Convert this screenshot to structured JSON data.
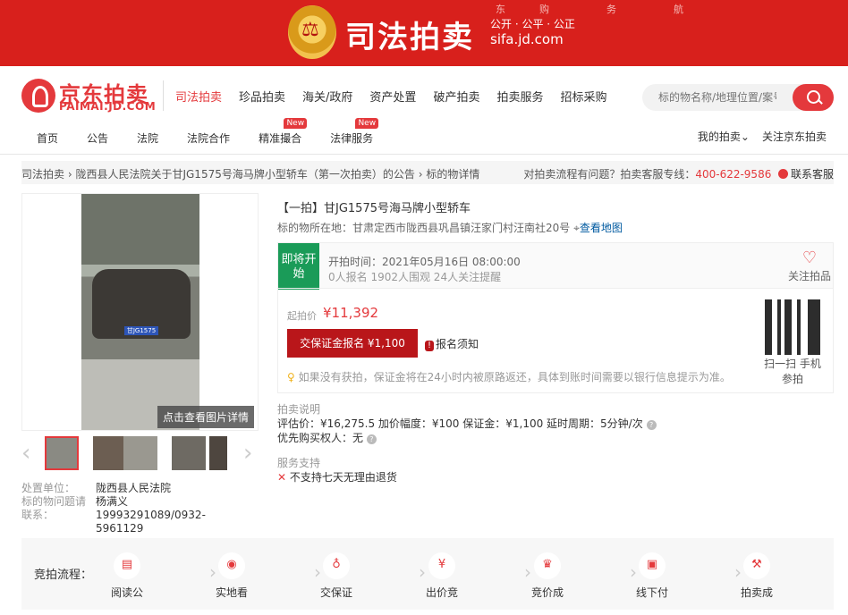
{
  "banner": {
    "title": "司法拍卖",
    "slogan": "公开 · 公平 · 公正",
    "domain": "sifa.jd.com",
    "nav": [
      "东",
      "购",
      "务",
      "航"
    ]
  },
  "logo": {
    "name": "京东拍卖",
    "sub": "PAIMAI.JD.COM"
  },
  "main_nav": [
    "司法拍卖",
    "珍品拍卖",
    "海关/政府",
    "资产处置",
    "破产拍卖",
    "拍卖服务",
    "招标采购"
  ],
  "search": {
    "placeholder": "标的物名称/地理位置/案号"
  },
  "sub_nav": [
    {
      "label": "首页",
      "badge": ""
    },
    {
      "label": "公告",
      "badge": ""
    },
    {
      "label": "法院",
      "badge": ""
    },
    {
      "label": "法院合作",
      "badge": ""
    },
    {
      "label": "精准撮合",
      "badge": "New"
    },
    {
      "label": "法律服务",
      "badge": "New"
    }
  ],
  "right_nav": {
    "my": "我的拍卖",
    "follow": "关注京东拍卖"
  },
  "breadcrumb": {
    "items": [
      "司法拍卖",
      "陇西县人民法院关于甘JG1575号海马牌小型轿车（第一次拍卖）的公告",
      "标的物详情"
    ],
    "help": "对拍卖流程有问题？拍卖客服专线：",
    "phone": "400-622-9586",
    "contact": "联系客服"
  },
  "photo": {
    "more": "点击查看图片详情",
    "plate": "甘JG1575"
  },
  "seller": {
    "unit_label": "处置单位：",
    "unit": "陇西县人民法院",
    "contact_label": "标的物问题请联系：",
    "contact": "杨满义 19993291089/0932-5961129"
  },
  "item": {
    "title": "【一拍】甘JG1575号海马牌小型轿车",
    "location_label": "标的物所在地：",
    "location": "甘肃定西市陇西县巩昌镇汪家门村汪南社20号",
    "map": "查看地图"
  },
  "status": {
    "tag": "即将开始",
    "time": "开拍时间：2021年05月16日 08:00:00",
    "stats": "0人报名   1902人围观   24人关注提醒",
    "follow": "关注拍品"
  },
  "price": {
    "label": "起拍价",
    "value": "¥11,392",
    "bid_button": "交保证金报名 ¥1,100",
    "notice": "报名须知",
    "tip": "如果没有获拍，保证金将在24小时内被原路返还，具体到账时间需要以银行信息提示为准。",
    "qr_text": "扫一扫 手机参拍"
  },
  "rules": {
    "heading": "拍卖说明",
    "line1": "评估价：¥16,275.5    加价幅度：¥100    保证金：¥1,100    延时周期：5分钟/次",
    "line2": "优先购买权人：无"
  },
  "service": {
    "heading": "服务支持",
    "item": "不支持七天无理由退货"
  },
  "flow": {
    "label": "竞拍流程：",
    "steps": [
      {
        "label": "阅读公",
        "icon": "document-icon",
        "glyph": "▤"
      },
      {
        "label": "实地看",
        "icon": "eye-icon",
        "glyph": "◉"
      },
      {
        "label": "交保证",
        "icon": "money-bag-icon",
        "glyph": "♁"
      },
      {
        "label": "出价竞",
        "icon": "yen-coin-icon",
        "glyph": "¥"
      },
      {
        "label": "竞价成",
        "icon": "thumbs-up-icon",
        "glyph": "♛"
      },
      {
        "label": "线下付",
        "icon": "wallet-icon",
        "glyph": "▣"
      },
      {
        "label": "拍卖成",
        "icon": "gavel-icon",
        "glyph": "⚒"
      }
    ]
  },
  "colors": {
    "brand_red": "#e4393c",
    "banner_red": "#d8201c",
    "status_green": "#1a9b58"
  }
}
